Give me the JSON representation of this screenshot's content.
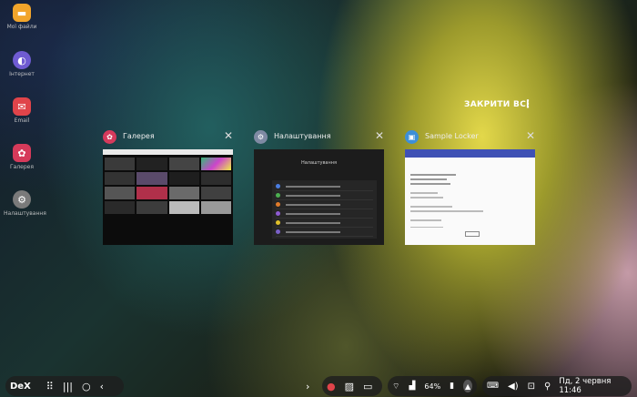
{
  "desktop": {
    "icons": [
      {
        "label": "Мої файли",
        "icon": "folder-icon",
        "color": "#f2a52b"
      },
      {
        "label": "Інтернет",
        "icon": "internet-icon",
        "color": "#6f5bd2"
      },
      {
        "label": "Email",
        "icon": "email-icon",
        "color": "#e0444a"
      },
      {
        "label": "Галерея",
        "icon": "gallery-icon",
        "color": "#d63a5a"
      },
      {
        "label": "Налаштування",
        "icon": "settings-icon",
        "color": "#7a7a7a"
      }
    ]
  },
  "recents": {
    "close_all": "ЗАКРИТИ ВСІ",
    "cards": [
      {
        "title": "Галерея",
        "icon": "flower-icon",
        "color": "#d53a5c"
      },
      {
        "title": "Налаштування",
        "icon": "gear-icon",
        "color": "#7f8aa3"
      },
      {
        "title": "Sample Locker",
        "icon": "lock-icon",
        "color": "#3d8fd8"
      }
    ],
    "settings_thumb_title": "Налаштування"
  },
  "taskbar": {
    "dex_label": "DeX",
    "battery": "64%",
    "clock": "Пд, 2 червня 11:46"
  }
}
